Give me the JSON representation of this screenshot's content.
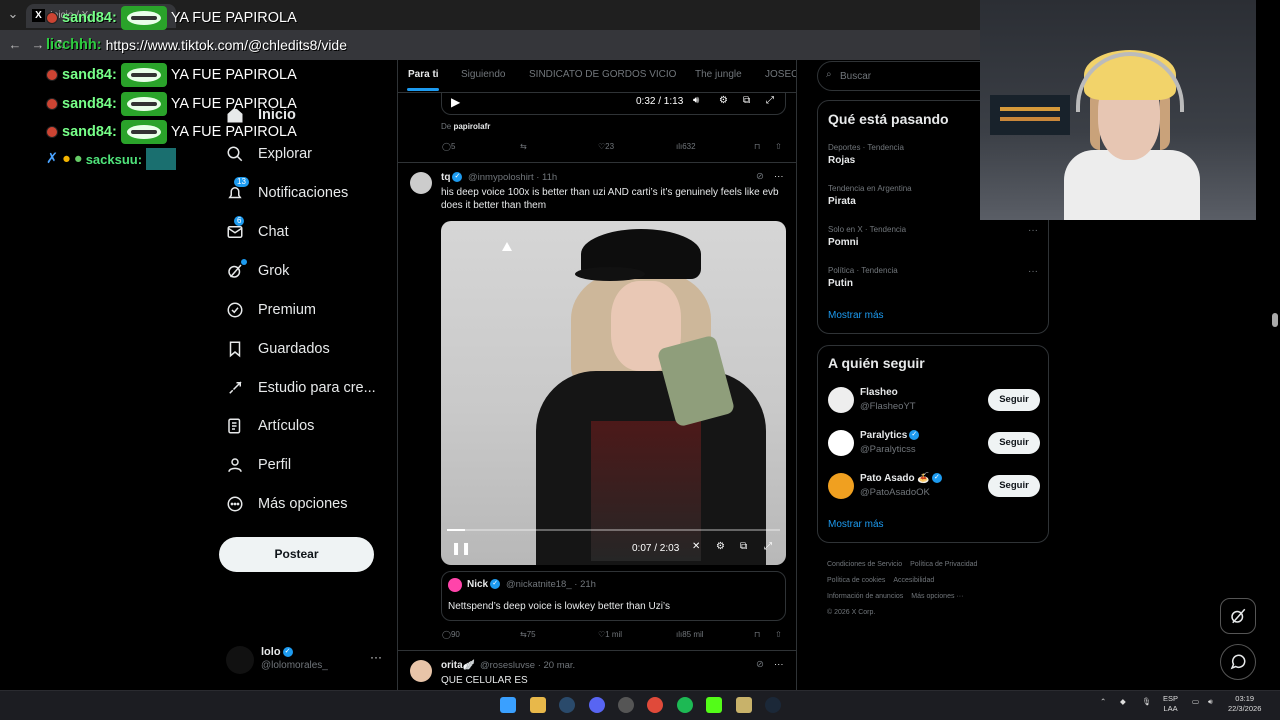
{
  "browser": {
    "tab_title": "Inicio / X",
    "url": "https://www.tiktok.com/@chledits8/vide"
  },
  "chat": [
    {
      "user": "sand84:",
      "message": "YA FUE PAPIROLA"
    },
    {
      "user": "licchhh:",
      "message": "https://www.tiktok.com/@chledits8/vide"
    },
    {
      "user": "sand84:",
      "message": "YA FUE PAPIROLA"
    },
    {
      "user": "sand84:",
      "message": "YA FUE PAPIROLA"
    },
    {
      "user": "sand84:",
      "message": "YA FUE PAPIROLA"
    },
    {
      "user": "sacksuu:",
      "message": ""
    }
  ],
  "sidebar": {
    "items": [
      {
        "label": "Inicio",
        "icon": "home-icon"
      },
      {
        "label": "Explorar",
        "icon": "search-icon"
      },
      {
        "label": "Notificaciones",
        "icon": "bell-icon",
        "badge": "13"
      },
      {
        "label": "Chat",
        "icon": "mail-icon",
        "badge": "6"
      },
      {
        "label": "Grok",
        "icon": "grok-icon"
      },
      {
        "label": "Premium",
        "icon": "verified-icon"
      },
      {
        "label": "Guardados",
        "icon": "bookmark-icon"
      },
      {
        "label": "Estudio para cre...",
        "icon": "rocket-icon"
      },
      {
        "label": "Artículos",
        "icon": "article-icon"
      },
      {
        "label": "Perfil",
        "icon": "person-icon"
      },
      {
        "label": "Más opciones",
        "icon": "more-circle-icon"
      }
    ],
    "post_label": "Postear",
    "account": {
      "name": "lolo",
      "handle": "@lolomorales_"
    }
  },
  "main": {
    "tabs": [
      "Para ti",
      "Siguiendo",
      "SINDICATO DE GORDOS VICIO",
      "The jungle",
      "JOSEO"
    ],
    "prev_post": {
      "video_time": "0:32 / 1:13",
      "from_label": "De",
      "from_user": "papirolafr",
      "replies": "5",
      "likes": "23",
      "views": "632"
    },
    "post": {
      "name": "tq",
      "handle": "@inmypoloshirt · 11h",
      "text": "his deep voice 100x is better than uzi AND carti’s it’s genuinely feels like evb does it better than them",
      "video_time": "0:07 / 2:03",
      "quote": {
        "name": "Nick",
        "handle": "@nickatnite18_ · 21h",
        "text": "Nettspend’s deep voice is lowkey better than Uzi’s"
      },
      "replies": "90",
      "reposts": "75",
      "likes": "1 mil",
      "views": "85 mil"
    },
    "next_post": {
      "name": "orita🪽",
      "handle": "@rosesluvse · 20 mar.",
      "text": "QUE CELULAR ES"
    }
  },
  "right": {
    "search_placeholder": "Buscar",
    "trends_title": "Qué está pasando",
    "trends": [
      {
        "context": "Deportes · Tendencia",
        "name": "Rojas"
      },
      {
        "context": "Tendencia en Argentina",
        "name": "Pirata"
      },
      {
        "context": "Solo en X · Tendencia",
        "name": "Pomni"
      },
      {
        "context": "Política · Tendencia",
        "name": "Putin"
      }
    ],
    "show_more": "Mostrar más",
    "follow_title": "A quién seguir",
    "follow": [
      {
        "name": "Flasheo",
        "handle": "@FlasheoYT",
        "button": "Seguir"
      },
      {
        "name": "Paralytics",
        "handle": "@Paralyticss",
        "button": "Seguir"
      },
      {
        "name": "Pato Asado 🍝",
        "handle": "@PatoAsadoOK",
        "button": "Seguir"
      }
    ],
    "footer": [
      "Condiciones de Servicio",
      "Política de Privacidad",
      "Política de cookies",
      "Accesibilidad",
      "Información de anuncios",
      "Más opciones ···",
      "© 2026 X Corp."
    ]
  },
  "taskbar": {
    "lang_top": "ESP",
    "lang_bottom": "LAA",
    "time": "03:19",
    "date": "22/3/2026"
  },
  "colors": {
    "accent": "#1d9bf0",
    "background": "#000000",
    "text": "#e7e9ea",
    "muted": "#71767b",
    "chat_user": "#7fff88"
  }
}
